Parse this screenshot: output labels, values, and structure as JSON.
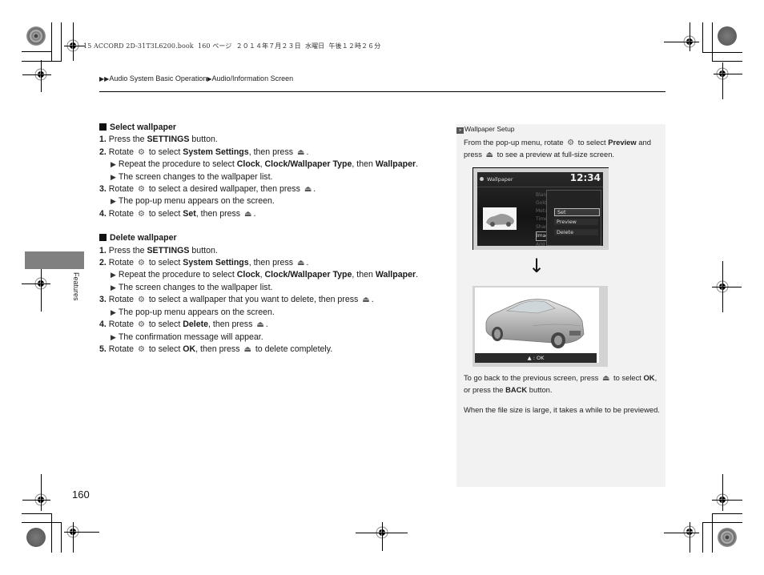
{
  "print_info": "15 ACCORD 2D-31T3L6200.book  160 ページ  ２０１４年７月２３日  水曜日  午後１２時２６分",
  "breadcrumb": {
    "items": [
      "Audio System Basic Operation",
      "Audio/Information Screen"
    ]
  },
  "side_tab": {
    "label": "Features"
  },
  "page_number": "160",
  "icons": {
    "rotate": "interface-dial-rotate-icon",
    "press": "interface-dial-press-icon",
    "triangle": "▶"
  },
  "sections": [
    {
      "title": "Select wallpaper",
      "steps": [
        {
          "num": "1.",
          "pre": "Press the ",
          "bold": "SETTINGS",
          "post": " button."
        },
        {
          "num": "2.",
          "pre": "Rotate ",
          "mid": " to select ",
          "bold": "System Settings",
          "post": ", then press ",
          "subs": [
            {
              "pre": "Repeat the procedure to select ",
              "b1": "Clock",
              "m1": ", ",
              "b2": "Clock/Wallpaper Type",
              "m2": ", then ",
              "b3": "Wallpaper",
              "post": "."
            },
            {
              "text": "The screen changes to the wallpaper list."
            }
          ]
        },
        {
          "num": "3.",
          "pre": "Rotate ",
          "mid": " to select a desired wallpaper, then press ",
          "subs": [
            {
              "text": "The pop-up menu appears on the screen."
            }
          ]
        },
        {
          "num": "4.",
          "pre": "Rotate ",
          "mid": " to select ",
          "bold": "Set",
          "post": ", then press "
        }
      ]
    },
    {
      "title": "Delete wallpaper",
      "steps": [
        {
          "num": "1.",
          "pre": "Press the ",
          "bold": "SETTINGS",
          "post": " button."
        },
        {
          "num": "2.",
          "pre": "Rotate ",
          "mid": " to select ",
          "bold": "System Settings",
          "post": ", then press ",
          "subs": [
            {
              "pre": "Repeat the procedure to select ",
              "b1": "Clock",
              "m1": ", ",
              "b2": "Clock/Wallpaper Type",
              "m2": ", then ",
              "b3": "Wallpaper",
              "post": "."
            },
            {
              "text": "The screen changes to the wallpaper list."
            }
          ]
        },
        {
          "num": "3.",
          "pre": "Rotate ",
          "mid": " to select a wallpaper that you want to delete, then press ",
          "subs": [
            {
              "text": "The pop-up menu appears on the screen."
            }
          ]
        },
        {
          "num": "4.",
          "pre": "Rotate ",
          "mid": " to select ",
          "bold": "Delete",
          "post": ", then press ",
          "subs": [
            {
              "text": "The confirmation message will appear."
            }
          ]
        },
        {
          "num": "5.",
          "pre": "Rotate ",
          "mid": " to select ",
          "bold": "OK",
          "post": ", then press ",
          "tail": " to delete completely."
        }
      ]
    }
  ],
  "sidebar": {
    "heading": "Wallpaper Setup",
    "p1": {
      "pre": "From the pop-up menu, rotate ",
      "mid": " to select ",
      "bold": "Preview",
      "post": " and press ",
      "tail": " to see a preview at full-size screen."
    },
    "screen1": {
      "title": "Wallpaper",
      "clock": "12:34",
      "list": [
        "Blan",
        "Gold",
        "Meta",
        "Time",
        "Shad",
        "Imag",
        "Add"
      ],
      "popup": [
        "Set",
        "Preview",
        "Delete"
      ],
      "popup_selected": "Set"
    },
    "arrow": "↓",
    "screen2": {
      "ok_label": "▲ : OK"
    },
    "p2": {
      "pre": "To go back to the previous screen, press ",
      "mid": " to select ",
      "b1": "OK",
      "m2": ", or press the ",
      "b2": "BACK",
      "post": " button."
    },
    "p3": "When the file size is large, it takes a while to be previewed."
  },
  "colors": {
    "sidebar_bg": "#f2f2f2",
    "tab_gray": "#808080",
    "screen_frame": "#d3d3d3"
  }
}
